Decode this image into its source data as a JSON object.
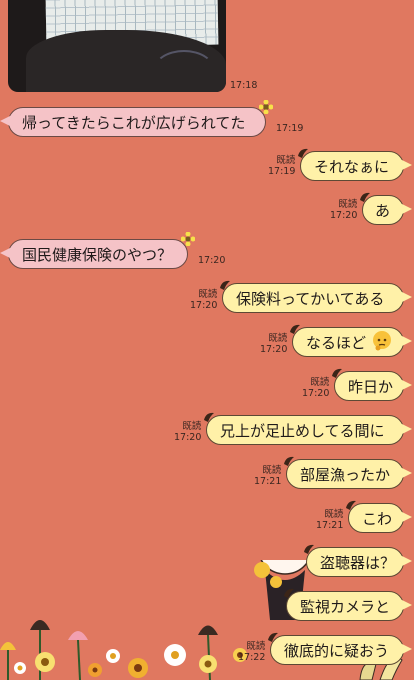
{
  "colors": {
    "background": "#e07860",
    "incoming": "#f5c3c7",
    "outgoing": "#fff1a8"
  },
  "photo": {
    "time": "17:18"
  },
  "read_label": "既読",
  "messages": [
    {
      "side": "left",
      "text": "帰ってきたらこれが広げられてた",
      "time": "17:19"
    },
    {
      "side": "right",
      "text": "それなぁに",
      "time": "17:19",
      "read": "既読"
    },
    {
      "side": "right",
      "text": "あ",
      "time": "17:20",
      "read": "既読"
    },
    {
      "side": "left",
      "text": "国民健康保険のやつ？",
      "time": "17:20"
    },
    {
      "side": "right",
      "text": "保険料ってかいてある",
      "time": "17:20",
      "read": "既読"
    },
    {
      "side": "right",
      "text": "なるほど",
      "emoji": "thinking-face-icon",
      "time": "17:20",
      "read": "既読"
    },
    {
      "side": "right",
      "text": "昨日か",
      "time": "17:20",
      "read": "既読"
    },
    {
      "side": "right",
      "text": "兄上が足止めしてる間に",
      "time": "17:20",
      "read": "既読"
    },
    {
      "side": "right",
      "text": "部屋漁ったか",
      "time": "17:21",
      "read": "既読"
    },
    {
      "side": "right",
      "text": "こわ",
      "time": "17:21",
      "read": "既読"
    },
    {
      "side": "right",
      "text": "盗聴器は？",
      "time": "",
      "read": ""
    },
    {
      "side": "right",
      "text": "監視カメラと",
      "time": "",
      "read": ""
    },
    {
      "side": "right",
      "text": "徹底的に疑おう",
      "time": "17:22",
      "read": "既読"
    }
  ]
}
